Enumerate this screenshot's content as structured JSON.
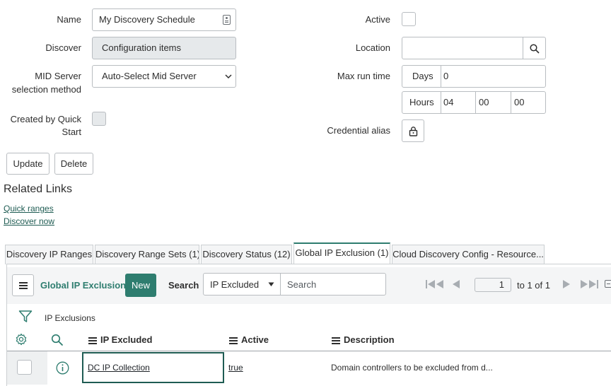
{
  "form": {
    "name_label": "Name",
    "name_value": "My Discovery Schedule",
    "discover_label": "Discover",
    "discover_value": "Configuration items",
    "mid_label_line1": "MID Server",
    "mid_label_line2": "selection method",
    "mid_value": "Auto-Select Mid Server",
    "quickstart_label_line1": "Created by Quick",
    "quickstart_label_line2": "Start",
    "active_label": "Active",
    "location_label": "Location",
    "location_value": "",
    "maxrun_label": "Max run time",
    "days_label": "Days",
    "days_value": "0",
    "hours_label": "Hours",
    "hours_value": "04",
    "minutes_value": "00",
    "seconds_value": "00",
    "credential_label": "Credential alias"
  },
  "buttons": {
    "update": "Update",
    "delete": "Delete"
  },
  "related_links": {
    "title": "Related Links",
    "links": [
      "Quick ranges",
      "Discover now"
    ]
  },
  "tabs": [
    "Discovery IP Ranges",
    "Discovery Range Sets (1)",
    "Discovery Status (12)",
    "Global IP Exclusion (1)",
    "Cloud Discovery Config - Resource..."
  ],
  "list": {
    "title": "Global IP Exclusion",
    "new_label": "New",
    "search_label": "Search",
    "search_field": "IP Excluded",
    "search_placeholder": "Search",
    "page_value": "1",
    "page_suffix": "to 1 of 1",
    "breadcrumb": "IP Exclusions",
    "columns": [
      "IP Excluded",
      "Active",
      "Description"
    ],
    "rows": [
      {
        "ip_excluded": "DC IP Collection",
        "active": "true",
        "description": "Domain controllers to be excluded from d..."
      }
    ]
  },
  "colors": {
    "accent": "#2e7d6f",
    "link": "#1f5c53",
    "new_button": "#2e7d6f"
  }
}
